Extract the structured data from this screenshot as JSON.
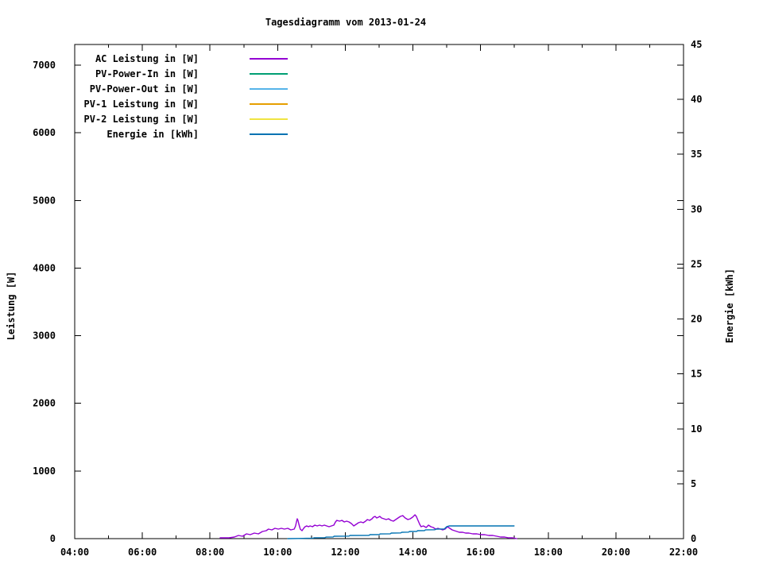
{
  "title": "Tagesdiagramm vom 2013-01-24",
  "chart_data": {
    "type": "line",
    "title": "Tagesdiagramm vom 2013-01-24",
    "grid": false,
    "x_axis": {
      "range": [
        4,
        22
      ],
      "ticks": [
        {
          "hour": 4,
          "label": "04:00"
        },
        {
          "hour": 6,
          "label": "06:00"
        },
        {
          "hour": 8,
          "label": "08:00"
        },
        {
          "hour": 10,
          "label": "10:00"
        },
        {
          "hour": 12,
          "label": "12:00"
        },
        {
          "hour": 14,
          "label": "14:00"
        },
        {
          "hour": 16,
          "label": "16:00"
        },
        {
          "hour": 18,
          "label": "18:00"
        },
        {
          "hour": 20,
          "label": "20:00"
        },
        {
          "hour": 22,
          "label": "22:00"
        }
      ],
      "minor_tick_hours": [
        5,
        7,
        9,
        11,
        13,
        15,
        17,
        19,
        21
      ]
    },
    "y_axis": {
      "label": "Leistung [W]",
      "range": [
        0,
        7306
      ],
      "ticks": [
        0,
        1000,
        2000,
        3000,
        4000,
        5000,
        6000,
        7000
      ],
      "tick_labels": [
        "0",
        "1000",
        "2000",
        "3000",
        "4000",
        "5000",
        "6000",
        "7000"
      ]
    },
    "y2_axis": {
      "label": "Energie [kWh]",
      "range": [
        0,
        45
      ],
      "ticks": [
        0,
        5,
        10,
        15,
        20,
        25,
        30,
        35,
        40,
        45
      ],
      "tick_labels": [
        "0",
        "5",
        "10",
        "15",
        "20",
        "25",
        "30",
        "35",
        "40",
        "45"
      ]
    },
    "legend": {
      "position": "top-left",
      "entries": [
        {
          "label": "AC Leistung in [W]",
          "color": "#9400d3"
        },
        {
          "label": "PV-Power-In in [W]",
          "color": "#009e73"
        },
        {
          "label": "PV-Power-Out in [W]",
          "color": "#56b4e9"
        },
        {
          "label": "PV-1 Leistung in [W]",
          "color": "#e69f00"
        },
        {
          "label": "PV-2 Leistung in [W]",
          "color": "#f0e442"
        },
        {
          "label": "Energie in [kWh]",
          "color": "#0072b2"
        }
      ]
    },
    "series": [
      {
        "id": "ac-leistung",
        "name": "AC Leistung in [W]",
        "color": "#9400d3",
        "axis": "y1",
        "points": [
          [
            8.3,
            12
          ],
          [
            8.56,
            12
          ],
          [
            8.72,
            23
          ],
          [
            8.84,
            47
          ],
          [
            8.96,
            35
          ],
          [
            9.08,
            70
          ],
          [
            9.19,
            59
          ],
          [
            9.31,
            82
          ],
          [
            9.43,
            70
          ],
          [
            9.55,
            106
          ],
          [
            9.66,
            117
          ],
          [
            9.73,
            141
          ],
          [
            9.83,
            129
          ],
          [
            9.92,
            153
          ],
          [
            10.02,
            141
          ],
          [
            10.11,
            153
          ],
          [
            10.2,
            141
          ],
          [
            10.3,
            153
          ],
          [
            10.39,
            129
          ],
          [
            10.49,
            141
          ],
          [
            10.53,
            188
          ],
          [
            10.56,
            258
          ],
          [
            10.58,
            294
          ],
          [
            10.6,
            270
          ],
          [
            10.63,
            211
          ],
          [
            10.67,
            141
          ],
          [
            10.72,
            117
          ],
          [
            10.77,
            153
          ],
          [
            10.81,
            176
          ],
          [
            10.86,
            188
          ],
          [
            10.91,
            176
          ],
          [
            10.96,
            188
          ],
          [
            11.03,
            176
          ],
          [
            11.1,
            200
          ],
          [
            11.17,
            188
          ],
          [
            11.24,
            200
          ],
          [
            11.31,
            188
          ],
          [
            11.38,
            200
          ],
          [
            11.45,
            188
          ],
          [
            11.52,
            176
          ],
          [
            11.59,
            188
          ],
          [
            11.66,
            200
          ],
          [
            11.71,
            247
          ],
          [
            11.75,
            270
          ],
          [
            11.83,
            258
          ],
          [
            11.9,
            270
          ],
          [
            11.97,
            247
          ],
          [
            12.04,
            258
          ],
          [
            12.11,
            247
          ],
          [
            12.18,
            223
          ],
          [
            12.25,
            188
          ],
          [
            12.32,
            211
          ],
          [
            12.39,
            235
          ],
          [
            12.46,
            247
          ],
          [
            12.53,
            235
          ],
          [
            12.6,
            258
          ],
          [
            12.65,
            282
          ],
          [
            12.72,
            270
          ],
          [
            12.79,
            294
          ],
          [
            12.83,
            317
          ],
          [
            12.88,
            329
          ],
          [
            12.93,
            305
          ],
          [
            12.98,
            317
          ],
          [
            13.02,
            329
          ],
          [
            13.07,
            305
          ],
          [
            13.14,
            294
          ],
          [
            13.21,
            282
          ],
          [
            13.28,
            294
          ],
          [
            13.35,
            270
          ],
          [
            13.42,
            258
          ],
          [
            13.49,
            282
          ],
          [
            13.56,
            305
          ],
          [
            13.63,
            329
          ],
          [
            13.7,
            341
          ],
          [
            13.77,
            305
          ],
          [
            13.85,
            282
          ],
          [
            13.92,
            294
          ],
          [
            13.99,
            317
          ],
          [
            14.06,
            352
          ],
          [
            14.1,
            329
          ],
          [
            14.15,
            270
          ],
          [
            14.2,
            211
          ],
          [
            14.24,
            176
          ],
          [
            14.31,
            188
          ],
          [
            14.39,
            164
          ],
          [
            14.46,
            200
          ],
          [
            14.53,
            176
          ],
          [
            14.6,
            164
          ],
          [
            14.67,
            141
          ],
          [
            14.74,
            153
          ],
          [
            14.81,
            141
          ],
          [
            14.88,
            129
          ],
          [
            14.95,
            141
          ],
          [
            15.02,
            176
          ],
          [
            15.09,
            153
          ],
          [
            15.16,
            129
          ],
          [
            15.23,
            117
          ],
          [
            15.3,
            106
          ],
          [
            15.37,
            94
          ],
          [
            15.47,
            94
          ],
          [
            15.56,
            82
          ],
          [
            15.65,
            82
          ],
          [
            15.77,
            70
          ],
          [
            15.89,
            70
          ],
          [
            16.01,
            59
          ],
          [
            16.12,
            59
          ],
          [
            16.24,
            47
          ],
          [
            16.36,
            47
          ],
          [
            16.48,
            35
          ],
          [
            16.59,
            23
          ],
          [
            16.71,
            23
          ],
          [
            16.83,
            12
          ],
          [
            16.95,
            12
          ],
          [
            17.07,
            0
          ]
        ]
      },
      {
        "id": "pv-power-in",
        "name": "PV-Power-In in [W]",
        "color": "#009e73",
        "axis": "y1",
        "points": []
      },
      {
        "id": "pv-power-out",
        "name": "PV-Power-Out in [W]",
        "color": "#56b4e9",
        "axis": "y1",
        "points": []
      },
      {
        "id": "pv1-leistung",
        "name": "PV-1 Leistung in [W]",
        "color": "#e69f00",
        "axis": "y1",
        "points": []
      },
      {
        "id": "pv2-leistung",
        "name": "PV-2 Leistung in [W]",
        "color": "#f0e442",
        "axis": "y1",
        "points": []
      },
      {
        "id": "energie",
        "name": "Energie in [kWh]",
        "color": "#0072b2",
        "axis": "y2",
        "points": [
          [
            10.3,
            0.0
          ],
          [
            10.85,
            0.03
          ],
          [
            11.05,
            0.04
          ],
          [
            11.08,
            0.08
          ],
          [
            11.4,
            0.09
          ],
          [
            11.43,
            0.14
          ],
          [
            11.64,
            0.15
          ],
          [
            11.67,
            0.22
          ],
          [
            12.11,
            0.23
          ],
          [
            12.14,
            0.29
          ],
          [
            12.7,
            0.3
          ],
          [
            12.73,
            0.36
          ],
          [
            13.0,
            0.37
          ],
          [
            13.03,
            0.43
          ],
          [
            13.33,
            0.44
          ],
          [
            13.36,
            0.51
          ],
          [
            13.64,
            0.52
          ],
          [
            13.67,
            0.58
          ],
          [
            13.87,
            0.59
          ],
          [
            13.9,
            0.65
          ],
          [
            14.11,
            0.66
          ],
          [
            14.14,
            0.72
          ],
          [
            14.34,
            0.73
          ],
          [
            14.37,
            0.8
          ],
          [
            14.65,
            0.81
          ],
          [
            14.68,
            0.87
          ],
          [
            14.93,
            0.88
          ],
          [
            15.0,
            1.09
          ],
          [
            15.07,
            1.16
          ],
          [
            15.6,
            1.16
          ],
          [
            16.2,
            1.16
          ],
          [
            16.99,
            1.16
          ]
        ]
      }
    ]
  }
}
